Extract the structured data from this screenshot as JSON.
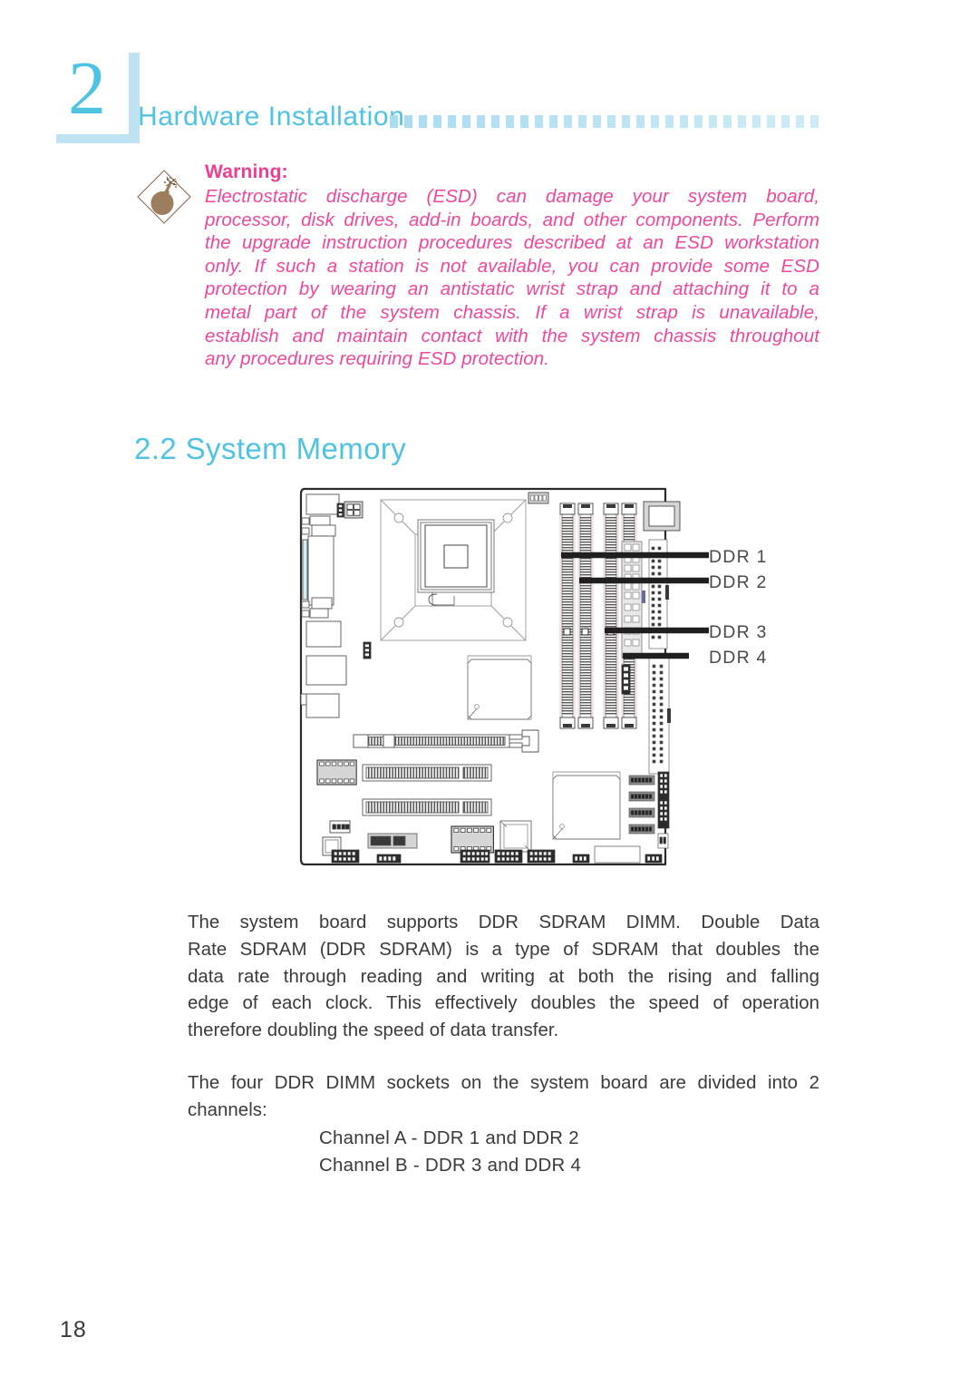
{
  "header": {
    "chapter_number": "2",
    "title": "Hardware Installation",
    "dot_count": 30,
    "accent_color": "#4ec3e2"
  },
  "warning": {
    "icon": "bomb-icon",
    "title": "Warning:",
    "color": "#f0479b",
    "line1": "Electrostatic discharge (ESD) can damage your system board,",
    "line2": "processor, disk drives, add-in boards, and other components. Perform",
    "line3": "the upgrade instruction procedures described at an ESD workstation",
    "line4": "only. If such a station is not available, you can provide some ESD",
    "line5": "protection by wearing an antistatic wrist strap and attaching it to a",
    "line6": "metal part of the system chassis. If a wrist strap is unavailable,",
    "line7": "establish and maintain contact with the system chassis throughout",
    "line8": "any procedures requiring ESD protection."
  },
  "section": {
    "number": "2.2",
    "title": "System Memory",
    "heading": "2.2 System Memory"
  },
  "figure": {
    "name": "system-board-diagram",
    "callouts": [
      {
        "label": "DDR 1"
      },
      {
        "label": "DDR 2"
      },
      {
        "label": "DDR 3"
      },
      {
        "label": "DDR 4"
      }
    ]
  },
  "body": {
    "paragraph1": "The system board supports DDR SDRAM DIMM. Double Data Rate SDRAM (DDR SDRAM) is a type of SDRAM that doubles the data rate through reading and writing at both the rising and falling edge of each clock. This effectively doubles the speed of operation therefore doubling the speed of data transfer.",
    "p1_lines": [
      "The system board supports DDR SDRAM DIMM. Double Data",
      "Rate SDRAM (DDR SDRAM) is a type of SDRAM that doubles the",
      "data rate through reading and writing at both the rising and falling",
      "edge of each clock. This effectively doubles the speed of operation",
      "therefore doubling the speed of data transfer."
    ],
    "paragraph2": "The four DDR DIMM sockets on the system board are divided into 2 channels:",
    "p2_lines": [
      "The four DDR DIMM sockets on the system board are divided into 2",
      "channels:"
    ],
    "channels": [
      "Channel A - DDR 1 and DDR 2",
      "Channel B - DDR 3 and DDR 4"
    ]
  },
  "footer": {
    "page_number": "18"
  }
}
